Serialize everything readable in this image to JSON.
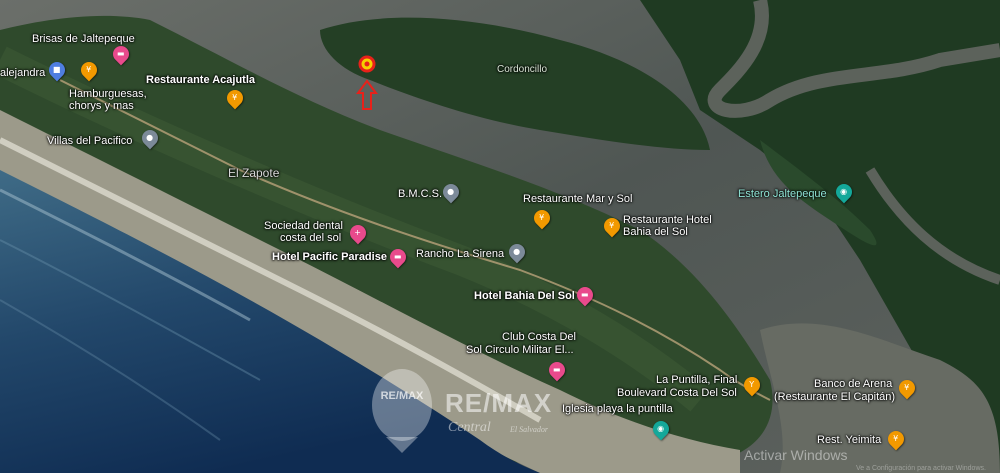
{
  "map": {
    "places": [
      {
        "id": "brisas",
        "text": "Brisas de Jaltepeque",
        "style": ""
      },
      {
        "id": "alejandra",
        "text": "alejandra",
        "style": ""
      },
      {
        "id": "acajutla",
        "text": "Restaurante Acajutla",
        "style": "b"
      },
      {
        "id": "hamb1",
        "text": "Hamburguesas,",
        "style": ""
      },
      {
        "id": "hamb2",
        "text": "chorys y mas",
        "style": ""
      },
      {
        "id": "villas",
        "text": "Villas del Pacifico",
        "style": ""
      },
      {
        "id": "cordoncillo",
        "text": "Cordoncillo",
        "style": "small"
      },
      {
        "id": "zapote",
        "text": "El Zapote",
        "style": "gray"
      },
      {
        "id": "bmcs",
        "text": "B.M.C.S.",
        "style": ""
      },
      {
        "id": "marysol",
        "text": "Restaurante Mar y Sol",
        "style": ""
      },
      {
        "id": "rhotel1",
        "text": "Restaurante Hotel",
        "style": ""
      },
      {
        "id": "rhotel2",
        "text": "Bahia del Sol",
        "style": ""
      },
      {
        "id": "estero",
        "text": "Estero Jaltepeque",
        "style": "teal"
      },
      {
        "id": "dental1",
        "text": "Sociedad dental",
        "style": ""
      },
      {
        "id": "dental2",
        "text": "costa del sol",
        "style": ""
      },
      {
        "id": "pacific",
        "text": "Hotel Pacific Paradise",
        "style": "b"
      },
      {
        "id": "sirena",
        "text": "Rancho La Sirena",
        "style": ""
      },
      {
        "id": "bahiadelsol",
        "text": "Hotel Bahia Del Sol",
        "style": "b"
      },
      {
        "id": "club1",
        "text": "Club Costa Del",
        "style": ""
      },
      {
        "id": "club2",
        "text": "Sol Circulo Militar El...",
        "style": ""
      },
      {
        "id": "puntilla1",
        "text": "La Puntilla, Final",
        "style": ""
      },
      {
        "id": "puntilla2",
        "text": "Boulevard Costa Del Sol",
        "style": ""
      },
      {
        "id": "iglesia",
        "text": "Iglesia playa la puntilla",
        "style": ""
      },
      {
        "id": "banco1",
        "text": "Banco de Arena",
        "style": ""
      },
      {
        "id": "banco2",
        "text": "(Restaurante El Capitán)",
        "style": ""
      },
      {
        "id": "yeimita",
        "text": "Rest. Yeimita",
        "style": ""
      }
    ],
    "icons": [
      {
        "id": "brisas",
        "type": "hotel",
        "glyph": "▬"
      },
      {
        "id": "alejandra",
        "type": "blue",
        "glyph": "■"
      },
      {
        "id": "hamb",
        "type": "food",
        "glyph": "¥"
      },
      {
        "id": "acajutla",
        "type": "food",
        "glyph": "¥"
      },
      {
        "id": "villas",
        "type": "gray",
        "glyph": "●"
      },
      {
        "id": "bmcs",
        "type": "gray",
        "glyph": "●"
      },
      {
        "id": "marysol",
        "type": "food",
        "glyph": "¥"
      },
      {
        "id": "rhotel",
        "type": "food",
        "glyph": "¥"
      },
      {
        "id": "estero",
        "type": "teal",
        "glyph": "◉"
      },
      {
        "id": "dental",
        "type": "hotel",
        "glyph": "+"
      },
      {
        "id": "pacific",
        "type": "hotel",
        "glyph": "▬"
      },
      {
        "id": "sirena",
        "type": "gray",
        "glyph": "●"
      },
      {
        "id": "bahiadelsol",
        "type": "hotel",
        "glyph": "▬"
      },
      {
        "id": "club",
        "type": "hotel",
        "glyph": "▬"
      },
      {
        "id": "puntilla",
        "type": "food",
        "glyph": "Y"
      },
      {
        "id": "iglesia",
        "type": "teal",
        "glyph": "◉"
      },
      {
        "id": "banco",
        "type": "food",
        "glyph": "¥"
      },
      {
        "id": "yeimita",
        "type": "food",
        "glyph": "¥"
      }
    ]
  },
  "watermark": {
    "brand": "RE/MAX",
    "sub": "Central",
    "sub2": "El Salvador",
    "logo_text": "RE/MAX"
  },
  "activate": {
    "line1": "Activar Windows",
    "line2": "Ve a Configuración para activar Windows."
  },
  "colors": {
    "marker": "#e8211a",
    "arrow": "#e8211a"
  }
}
